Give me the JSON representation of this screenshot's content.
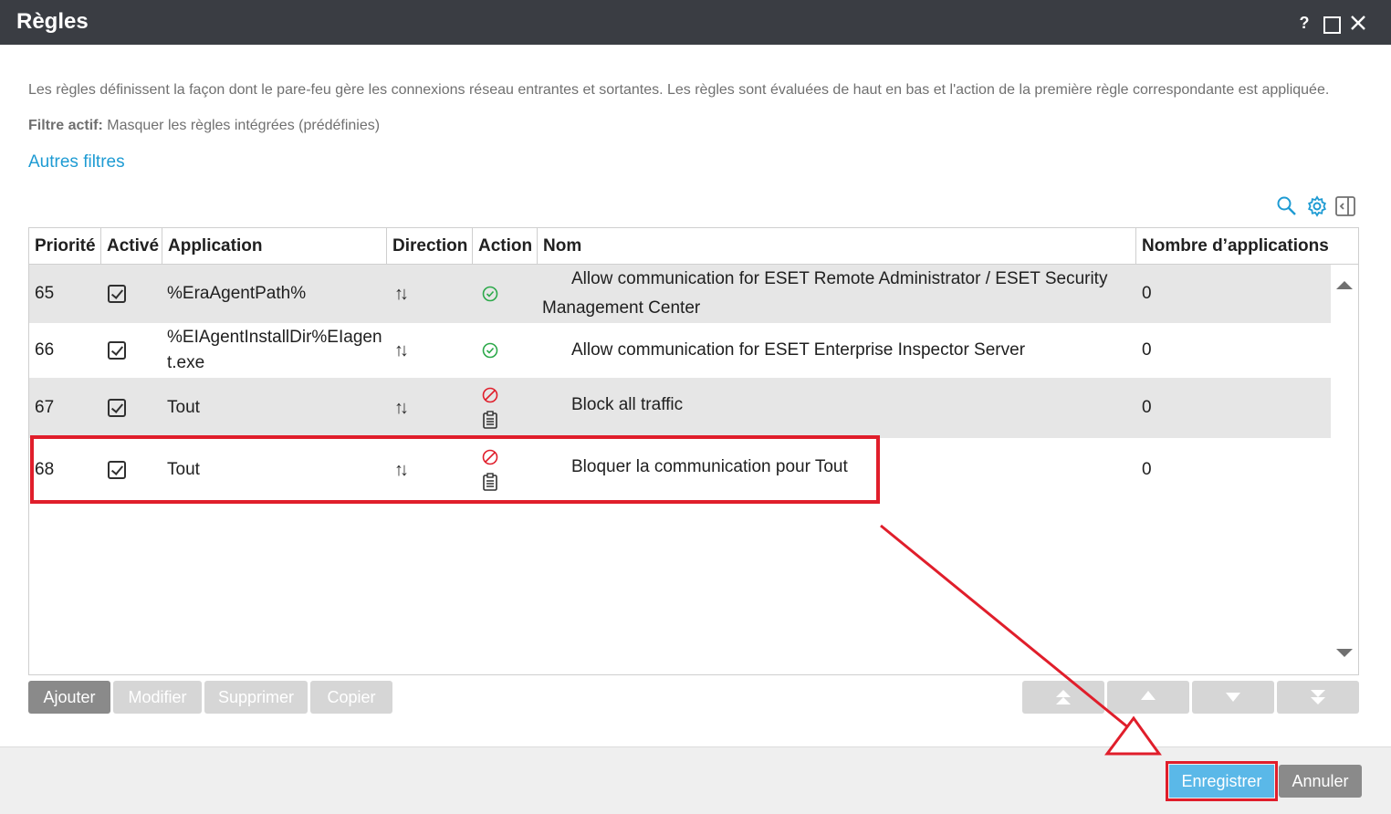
{
  "window": {
    "title": "Règles",
    "help_label": "?"
  },
  "description": "Les règles définissent la façon dont le pare-feu gère les connexions réseau entrantes et sortantes. Les règles sont évaluées de haut en bas et l'action de la première règle correspondante est appliquée.",
  "filter": {
    "label": "Filtre actif:",
    "value": "Masquer les règles intégrées (prédéfinies)"
  },
  "other_filters_link": "Autres filtres",
  "table": {
    "columns": [
      "Priorité",
      "Activé",
      "Application",
      "Direction",
      "Action",
      "Nom",
      "Nombre d’applications"
    ],
    "rows": [
      {
        "priority": "65",
        "enabled": true,
        "application": "%EraAgentPath%",
        "direction": "in-out",
        "action": "allow",
        "name_line1": "Allow communication for ESET Remote Administrator / ESET Security",
        "name_line2": "Management Center",
        "count": "0"
      },
      {
        "priority": "66",
        "enabled": true,
        "application": "%EIAgentInstallDir%EIagent.exe",
        "direction": "in-out",
        "action": "allow",
        "name_line1": "Allow communication for ESET Enterprise Inspector Server",
        "name_line2": "",
        "count": "0"
      },
      {
        "priority": "67",
        "enabled": true,
        "application": "Tout",
        "direction": "in-out",
        "action": "block-log",
        "name_line1": "Block all traffic",
        "name_line2": "",
        "count": "0"
      },
      {
        "priority": "68",
        "enabled": true,
        "application": "Tout",
        "direction": "in-out",
        "action": "block-log",
        "name_line1": "Bloquer la communication pour Tout",
        "name_line2": "",
        "count": "0"
      }
    ]
  },
  "buttons": {
    "add": "Ajouter",
    "edit": "Modifier",
    "delete": "Supprimer",
    "copy": "Copier",
    "save": "Enregistrer",
    "cancel": "Annuler"
  },
  "icons": {
    "search": "search-icon",
    "settings": "gear-icon",
    "panel": "collapse-panel-icon",
    "allow": "check-circle-icon",
    "block": "block-icon",
    "log": "clipboard-icon",
    "direction": "up-down-arrows-icon"
  },
  "colors": {
    "accent": "#1e9bd3",
    "allow": "#2ca94a",
    "block": "#e01e2b",
    "highlight": "#e01e2b",
    "titlebar": "#3a3d43"
  }
}
